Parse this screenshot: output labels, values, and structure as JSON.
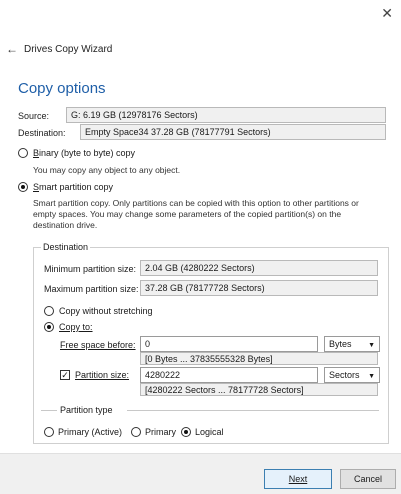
{
  "window": {
    "close_glyph": "✕",
    "back_glyph": "←",
    "title": "Drives Copy Wizard"
  },
  "heading": "Copy options",
  "source": {
    "label": "Source:",
    "value": "G: 6.19 GB (12978176 Sectors)"
  },
  "destination_field": {
    "label": "Destination:",
    "value": "Empty Space34 37.28 GB (78177791 Sectors)"
  },
  "binary": {
    "label": "Binary (byte to byte) copy",
    "desc": "You may copy any object to any object."
  },
  "smart": {
    "label": "Smart partition copy",
    "desc": [
      "Smart partition copy. Only  partitions can be copied with this option to other partitions or",
      "empty spaces. You may change some parameters of the copied partition(s) on the",
      "destination drive."
    ]
  },
  "dest_group": {
    "title": "Destination",
    "min_label": "Minimum partition size:",
    "min_value": "2.04 GB (4280222 Sectors)",
    "max_label": "Maximum partition size:",
    "max_value": "37.28 GB (78177728 Sectors)",
    "without_stretching": "Copy without stretching",
    "copy_to": "Copy to:",
    "free_space_label": "Free space before:",
    "free_space_value": "0",
    "free_space_unit": "Bytes",
    "free_space_range": "[0 Bytes ... 37835555328 Bytes]",
    "partition_size_label": "Partition size:",
    "partition_size_value": "4280222",
    "partition_size_unit": "Sectors",
    "partition_size_range": "[4280222 Sectors ... 78177728 Sectors]"
  },
  "partition_type": {
    "title": "Partition type",
    "options": [
      "Primary (Active)",
      "Primary",
      "Logical"
    ]
  },
  "buttons": {
    "next": "Next",
    "cancel": "Cancel"
  }
}
